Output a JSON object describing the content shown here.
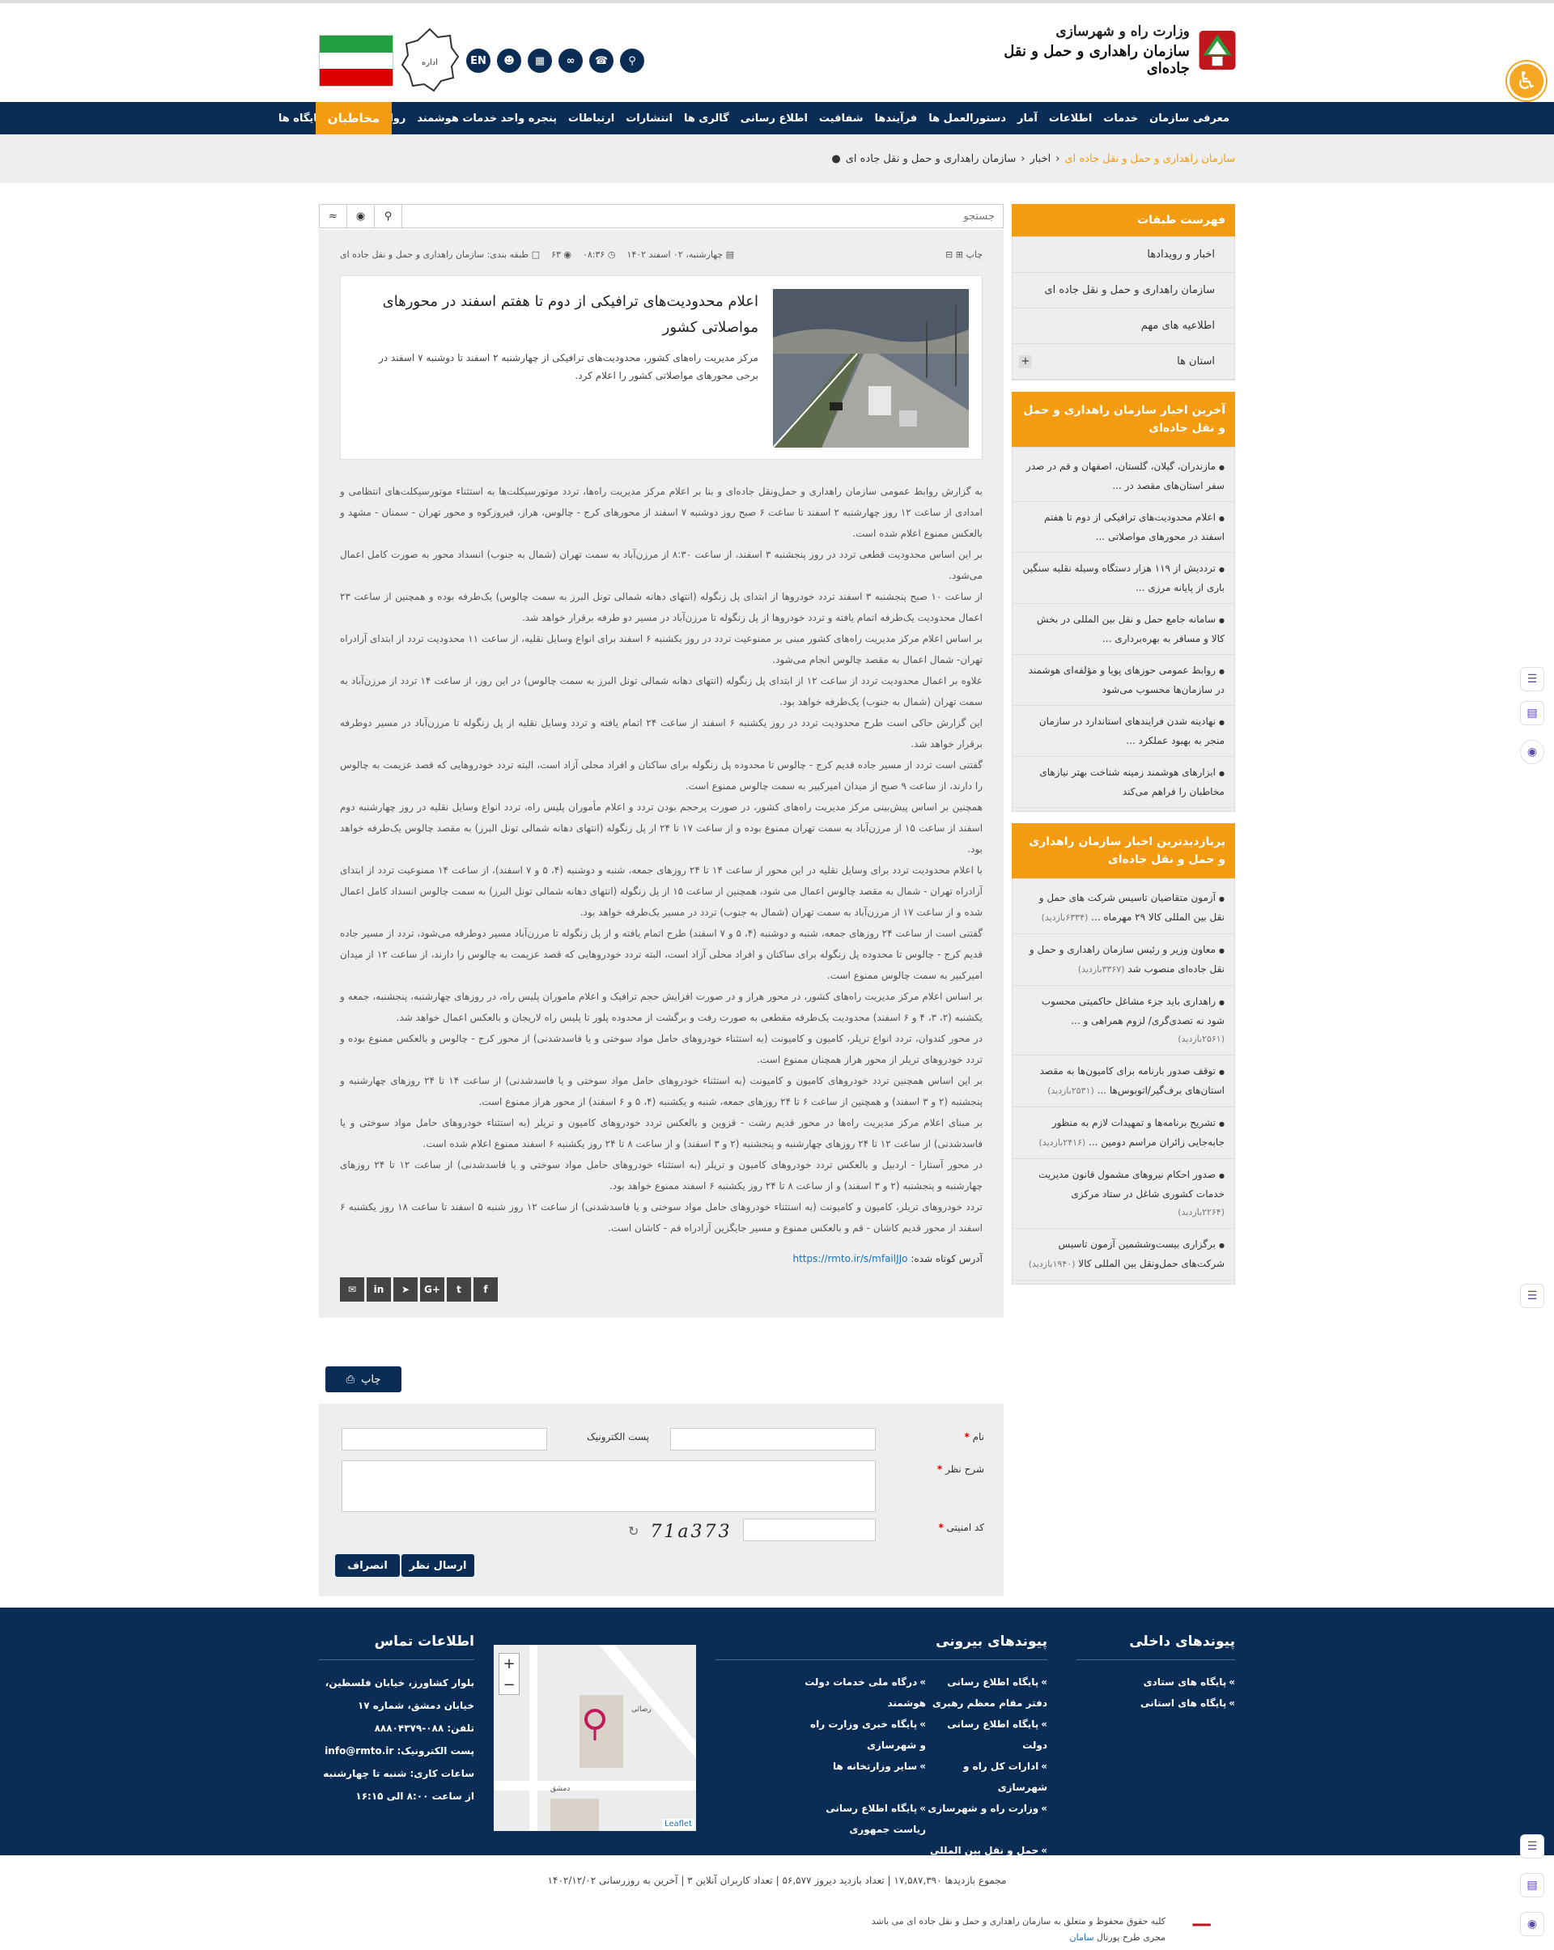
{
  "header": {
    "ministry": "وزارت راه و شهرسازی",
    "org": "سازمان راهداری و حمل و نقل جاده‌ای",
    "seal_text": "سازمان راهداری و حمل و نقل جاده ای",
    "lang_button": "EN",
    "flag_colors": [
      "#239f40",
      "#ffffff",
      "#da0000"
    ]
  },
  "nav": {
    "items": [
      "معرفی سازمان",
      "خدمات",
      "اطلاعات",
      "آمار",
      "دستورالعمل ها",
      "فرآیندها",
      "شفافیت",
      "اطلاع رسانی",
      "گالری ها",
      "انتشارات",
      "ارتباطات",
      "پنجره واحد خدمات هوشمند",
      "روابط عمومی",
      "پایگاه ها"
    ],
    "contacts": "مخاطبان"
  },
  "breadcrumb": [
    "سازمان راهداری و حمل و نقل جاده ای",
    "اخبار",
    "سازمان راهداری و حمل و نقل جاده ای"
  ],
  "search": {
    "placeholder": "جستجو"
  },
  "article": {
    "date": "چهارشنبه، ۰۲ اسفند ۱۴۰۲",
    "time": "۰۸:۳۶",
    "views": "۶۳",
    "category": "طبقه بندی: سازمان راهداری و حمل و نقل جاده ای",
    "print_label": "چاپ",
    "title": "اعلام محدودیت‌های ترافیکی از دوم تا هفتم اسفند در محورهای مواصلاتی کشور",
    "lead": "مرکز مدیریت راه‌های کشور، محدودیت‌های ترافیکی از چهارشنبه ۲ اسفند تا دوشنبه ۷ اسفند در برخی محورهای مواصلاتی کشور را اعلام کرد.",
    "paragraphs": [
      "به گزارش روابط عمومی سازمان راهداری و حمل‌ونقل جاده‌ای و بنا بر اعلام مرکز مدیریت راه‌ها، تردد موتورسیکلت‌ها به استثناء موتورسیکلت‌های انتظامی و امدادی از ساعت ۱۲ روز چهارشنبه ۲ اسفند تا ساعت ۶ صبح روز دوشنبه ۷ اسفند از محورهای کرج - چالوس، هراز، فیروزکوه و محور تهران - سمنان - مشهد و بالعکس ممنوع اعلام شده است.",
      "بر این اساس محدودیت قطعی تردد در روز پنجشنبه ۳ اسفند، از ساعت ۸:۳۰ از مرزن‌آباد به سمت تهران (شمال به جنوب) انسداد محور به صورت کامل اعمال می‌شود.",
      "از ساعت ۱۰ صبح پنجشنبه ۳ اسفند تردد خودروها از ابتدای پل زنگوله (انتهای دهانه شمالی تونل البرز به سمت چالوس) یک‌طرفه بوده و همچنین از ساعت ۲۳ اعمال محدودیت یک‌طرفه اتمام یافته و تردد خودروها از پل زنگوله تا مرزن‌آباد در مسیر دو طرفه برقرار خواهد شد.",
      "بر اساس اعلام مرکز مدیریت راه‌های کشور مبنی بر ممنوعیت تردد در روز یکشنبه ۶ اسفند برای انواع وسایل نقلیه، از ساعت ۱۱ محدودیت تردد از ابتدای آزادراه تهران- شمال اعمال به مقصد چالوس انجام می‌شود.",
      "علاوه بر اعمال محدودیت تردد از ساعت ۱۲ از ابتدای پل زنگوله (انتهای دهانه شمالی تونل البرز به سمت چالوس) در این روز، از ساعت ۱۴ تردد از مرزن‌آباد به سمت تهران (شمال به جنوب) یک‌طرفه خواهد بود.",
      "این گزارش حاکی است طرح محدودیت تردد در روز یکشنبه ۶ اسفند از ساعت ۲۴ اتمام یافته و تردد وسایل نقلیه از پل زنگوله تا مرزن‌آباد در مسیر دوطرفه برقرار خواهد شد.",
      "گفتنی است تردد از مسیر جاده قدیم کرج - چالوس تا محدوده پل زنگوله برای ساکنان و افراد محلی آزاد است، البته تردد خودروهایی که قصد عزیمت به چالوس را دارند، از ساعت ۹ صبح از میدان امیرکبیر به سمت چالوس ممنوع است.",
      "همچنین بر اساس پیش‌بینی مرکز مدیریت راه‌های کشور، در صورت پرحجم بودن تردد و اعلام مأموران پلیس راه، تردد انواع وسایل نقلیه در روز چهارشنبه دوم اسفند از ساعت ۱۵ از مرزن‌آباد به سمت تهران ممنوع بوده و از ساعت ۱۷ تا ۲۴ از پل زنگوله (انتهای دهانه شمالی تونل البرز) به مقصد چالوس یک‌طرفه خواهد بود.",
      "با اعلام محدودیت تردد برای وسایل نقلیه در این محور از ساعت ۱۴ تا ۲۴ روزهای جمعه، شنبه و دوشنبه (۴، ۵ و ۷ اسفند)، از ساعت ۱۴ ممنوعیت تردد از ابتدای آزادراه تهران - شمال به مقصد چالوس اعمال می شود، همچنین از ساعت ۱۵ از پل زنگوله (انتهای دهانه شمالی تونل البرز) به سمت چالوس انسداد کامل اعمال شده و از ساعت ۱۷ از مرزن‌آباد به سمت تهران (شمال به جنوب) تردد در مسیر یک‌طرفه خواهد بود.",
      "گفتنی است از ساعت ۲۴ روزهای جمعه، شنبه و دوشنبه (۴، ۵ و ۷ اسفند) طرح اتمام یافته و از پل زنگوله تا مرزن‌آباد مسیر دوطرفه می‌شود، تردد از مسیر جاده قدیم کرج - چالوس تا محدوده پل زنگوله برای ساکنان و افراد محلی آزاد است، البته تردد خودروهایی که قصد عزیمت به چالوس را دارند، از ساعت ۱۲ از میدان امیرکبیر به سمت چالوس ممنوع است.",
      "بر اساس اعلام مرکز مدیریت راه‌های کشور، در محور هراز و در صورت افزایش حجم ترافیک و اعلام ماموران پلیس راه، در روزهای چهارشنبه، پنجشنبه، جمعه و یکشنبه (۲، ۳، ۴ و ۶ اسفند) محدودیت یک‌طرفه مقطعی به صورت رفت و برگشت از محدوده پلور تا پلیس راه لاریجان و بالعکس اعمال خواهد شد.",
      "در محور کندوان، تردد انواع تریلر، کامیون و کامیونت (به استثناء خودروهای حامل مواد سوختی و یا فاسدشدنی) از محور کرج - چالوس و بالعکس ممنوع بوده و تردد خودروهای تریلر از محور هراز همچنان ممنوع است.",
      "بر این اساس همچنین تردد خودروهای کامیون و کامیونت (به استثناء خودروهای حامل مواد سوختی و یا فاسدشدنی) از ساعت ۱۴ تا ۲۴ روزهای چهارشنبه و پنجشنبه (۲ و ۳ اسفند) و همچنین از ساعت ۶ تا ۲۴ روزهای جمعه، شنبه و یکشنبه (۴، ۵ و ۶ اسفند) از محور هراز ممنوع است.",
      "بر مبنای اعلام مرکز مدیریت راه‌ها در محور قدیم رشت - قزوین و بالعکس تردد خودروهای کامیون و تریلر (به استثناء خودروهای حامل مواد سوختی و یا فاسدشدنی) از ساعت ۱۲ تا ۲۴ روزهای چهارشنبه و پنجشنبه (۲ و ۳ اسفند) و از ساعت ۸ تا ۲۴ روز یکشنبه ۶ اسفند ممنوع اعلام شده است.",
      "در محور آستارا - اردبیل و بالعکس تردد خودروهای کامیون و تریلر (به استثناء خودروهای حامل مواد سوختی و یا فاسدشدنی) از ساعت ۱۲ تا ۲۴ روزهای چهارشنبه و پنجشنبه (۲ و ۳ اسفند) و از ساعت ۸ تا ۲۴ روز یکشنبه ۶ اسفند ممنوع خواهد بود.",
      "تردد خودروهای تریلر، کامیون و کامیونت (به استثناء خودروهای حامل مواد سوختی و یا فاسدشدنی) از ساعت ۱۲ روز شنبه ۵ اسفند تا ساعت ۱۸ روز یکشنبه ۶ اسفند از محور قدیم کاشان - قم و بالعکس ممنوع و مسیر جایگزین آزادراه قم - کاشان است."
    ],
    "shortlink_label": "آدرس کوتاه شده:",
    "shortlink": "https://rmto.ir/s/mfailJJo"
  },
  "share_icons": [
    "f",
    "t",
    "G+",
    "tg",
    "in",
    "mail"
  ],
  "print_button": "چاپ",
  "comment_form": {
    "name": "نام",
    "email": "پست الکترونیک",
    "comment": "شرح نظر",
    "captcha_label": "کد امنیتی",
    "captcha_text": "71a373",
    "submit": "ارسال نظر",
    "cancel": "انصراف"
  },
  "sidebar": {
    "cats_title": "فهرست طبقات",
    "cats": [
      "اخبار و رویدادها",
      "سازمان راهداری و حمل و نقل جاده ای",
      "اطلاعیه های مهم",
      "استان ها"
    ],
    "latest_title": "آخرین اخبار سازمان راهداری و حمل و نقل جاده‌ای",
    "latest": [
      "مازندران، گیلان، گلستان، اصفهان و قم در صدر سفر استان‌های مقصد در ...",
      "اعلام محدودیت‌های ترافیکی از دوم تا هفتم اسفند در محورهای مواصلاتی ...",
      "ترددیش از ۱۱۹ هزار دستگاه وسیله نقلیه سنگین باری از پایانه مرزی ...",
      "سامانه جامع حمل و نقل بین المللی در بخش کالا و مسافر به بهره‌برداری ...",
      "روابط عمومی حوزهای پویا و مؤلفه‌ای هوشمند در سازمان‌ها محسوب می‌شود",
      "نهادینه شدن فرایندهای استاندارد در سازمان منجر به بهبود عملکرد ...",
      "ابزارهای هوشمند زمینه شناخت بهتر نیازهای مخاطبان را فراهم می‌کند"
    ],
    "popular_title": "پربازدیدترین اخبار سازمان راهداری و حمل و نقل جاده‌ای",
    "popular": [
      {
        "t": "آزمون متقاضیان تاسیس شرکت های حمل و نقل بین المللی کالا ۲۹ مهرماه ...",
        "v": "(۶۳۳۴بازدید)"
      },
      {
        "t": "معاون وزیر و رئیس سازمان راهداری و حمل و نقل جاده‌ای منصوب شد",
        "v": "(۳۳۶۷بازدید)"
      },
      {
        "t": "راهداری باید جزء مشاغل حاکمیتی محسوب شود نه تصدی‌گری/ لزوم همراهی و ...",
        "v": "(۲۵۶۱بازدید)"
      },
      {
        "t": "توقف صدور بارنامه برای کامیون‌ها به مقصد استان‌های برف‌گیر/اتوبوس‌ها ...",
        "v": "(۲۵۳۱بازدید)"
      },
      {
        "t": "تشریح برنامه‌ها و تمهیدات لازم به منظور جابه‌جایی زائران مراسم دومین ...",
        "v": "(۲۴۱۶بازدید)"
      },
      {
        "t": "صدور احکام نیروهای مشمول قانون مدیریت خدمات کشوری شاغل در ستاد مرکزی",
        "v": "(۲۲۶۴بازدید)"
      },
      {
        "t": "برگزاری بیست‌وششمین آزمون تاسیس شرکت‌های حمل‌ونقل بین المللی کالا",
        "v": "(۱۹۴۰بازدید)"
      }
    ]
  },
  "footer": {
    "internal_title": "پیوندهای داخلی",
    "internal": [
      "پایگاه های ستادی",
      "پایگاه های استانی"
    ],
    "external_title": "پیوندهای بیرونی",
    "external": [
      "پایگاه اطلاع رسانی دفتر مقام معظم رهبری",
      "درگاه ملی خدمات دولت هوشمند",
      "پایگاه اطلاع رسانی دولت",
      "پایگاه خبری وزارت راه و شهرسازی",
      "ادارات کل راه و شهرسازی",
      "سایر وزارتخانه ها",
      "وزارت راه و شهرسازی",
      "پایگاه اطلاع رسانی ریاست جمهوری",
      "حمل و نقل بین المللی"
    ],
    "contact_title": "اطلاعات تماس",
    "contact": [
      "بلوار کشاورز، خیابان فلسطین،",
      "خیابان دمشق، شماره ۱۷",
      "تلفن: ۰۸۸-۸۸۸۰۴۳۷۹",
      "پست الکترونیک: info@rmto.ir",
      "ساعات کاری: شنبه تا چهارشنبه",
      "از ساعت ۸:۰۰ الی ۱۶:۱۵"
    ],
    "map_labels": [
      "رضائی",
      "دمشق",
      "Leaflet",
      "+",
      "−"
    ]
  },
  "stats": "مجموع بازدیدها   ۱۷,۵۸۷,۳۹۰   |   تعداد بازدید دیروز   ۵۶,۵۷۷   |   تعداد کاربران آنلاین   ۳   |   آخرین به روزرسانی   ۱۴۰۲/۱۲/۰۲",
  "copyright": {
    "line1": "کلیه حقوق محفوظ و متعلق به سازمان راهداری و حمل و نقل جاده ای می باشد",
    "line2": "مجری طرح پورتال ",
    "sm": "سامان"
  }
}
